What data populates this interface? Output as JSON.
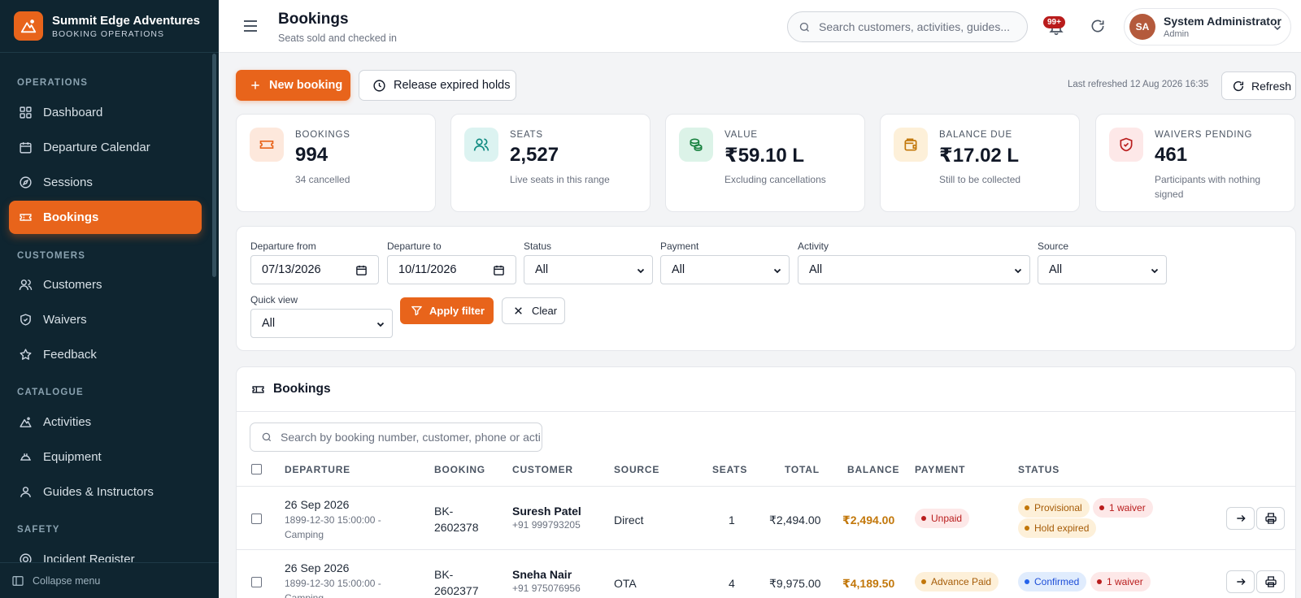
{
  "brand": {
    "name": "Summit Edge Adventures",
    "subtitle": "BOOKING OPERATIONS"
  },
  "sidebar": {
    "sections": {
      "operations": "OPERATIONS",
      "customers": "CUSTOMERS",
      "catalogue": "CATALOGUE",
      "safety": "SAFETY"
    },
    "items": {
      "dashboard": "Dashboard",
      "departure_calendar": "Departure Calendar",
      "sessions": "Sessions",
      "bookings": "Bookings",
      "customers": "Customers",
      "waivers": "Waivers",
      "feedback": "Feedback",
      "activities": "Activities",
      "equipment": "Equipment",
      "guides": "Guides & Instructors",
      "incident_register": "Incident Register"
    },
    "active_item": "Bookings",
    "collapse_label": "Collapse menu"
  },
  "header": {
    "title": "Bookings",
    "subtitle": "Seats sold and checked in",
    "search_placeholder": "Search customers, activities, guides...",
    "notification_badge": "99+",
    "user": {
      "initials": "SA",
      "name": "System Administrator",
      "role": "Admin"
    }
  },
  "actions": {
    "new_booking": "New booking",
    "release_holds": "Release expired holds",
    "last_refreshed": "Last refreshed 12 Aug 2026 16:35",
    "refresh": "Refresh"
  },
  "kpis": [
    {
      "label": "BOOKINGS",
      "value": "994",
      "note": "34 cancelled",
      "icon": "ticket-icon",
      "bg": "#fde8dc",
      "fg": "#e8641b"
    },
    {
      "label": "SEATS",
      "value": "2,527",
      "note": "Live seats in this range",
      "icon": "users-icon",
      "bg": "#dcf3f1",
      "fg": "#0f8a80"
    },
    {
      "label": "VALUE",
      "value": "₹59.10 L",
      "note": "Excluding cancellations",
      "icon": "coins-icon",
      "bg": "#dcf3e8",
      "fg": "#15803d"
    },
    {
      "label": "BALANCE DUE",
      "value": "₹17.02 L",
      "note": "Still to be collected",
      "icon": "wallet-icon",
      "bg": "#fdf0d9",
      "fg": "#c2770a"
    },
    {
      "label": "WAIVERS PENDING",
      "value": "461",
      "note": "Participants with nothing signed",
      "icon": "shield-icon",
      "bg": "#fde8e8",
      "fg": "#b91c1c"
    }
  ],
  "filters": {
    "departure_from": {
      "label": "Departure from",
      "value": "07/13/2026"
    },
    "departure_to": {
      "label": "Departure to",
      "value": "10/11/2026"
    },
    "status": {
      "label": "Status",
      "value": "All"
    },
    "payment": {
      "label": "Payment",
      "value": "All"
    },
    "activity": {
      "label": "Activity",
      "value": "All"
    },
    "source": {
      "label": "Source",
      "value": "All"
    },
    "quick_view": {
      "label": "Quick view",
      "value": "All"
    },
    "apply": "Apply filter",
    "clear": "Clear"
  },
  "table": {
    "title": "Bookings",
    "search_placeholder": "Search by booking number, customer, phone or acti",
    "columns": {
      "departure": "DEPARTURE",
      "booking": "BOOKING",
      "customer": "CUSTOMER",
      "source": "SOURCE",
      "seats": "SEATS",
      "total": "TOTAL",
      "balance": "BALANCE",
      "payment": "PAYMENT",
      "status": "STATUS"
    },
    "rows": [
      {
        "date": "26 Sep 2026",
        "time_line": "1899-12-30 15:00:00 -",
        "activity": "Camping",
        "booking_a": "BK-",
        "booking_b": "2602378",
        "customer": "Suresh Patel",
        "phone": "+91 999793205",
        "source": "Direct",
        "seats": "1",
        "total": "₹2,494.00",
        "balance": "₹2,494.00",
        "payment": "Unpaid",
        "status": "Provisional",
        "waiver": "1 waiver",
        "hold": "Hold expired"
      },
      {
        "date": "26 Sep 2026",
        "time_line": "1899-12-30 15:00:00 -",
        "activity": "Camping",
        "booking_a": "BK-",
        "booking_b": "2602377",
        "customer": "Sneha Nair",
        "phone": "+91 975076956",
        "source": "OTA",
        "seats": "4",
        "total": "₹9,975.00",
        "balance": "₹4,189.50",
        "payment": "Advance Paid",
        "status": "Confirmed",
        "waiver": "1 waiver"
      }
    ]
  },
  "colors": {
    "accent": "#e8641b",
    "sidebar_bg": "#0f2530"
  }
}
